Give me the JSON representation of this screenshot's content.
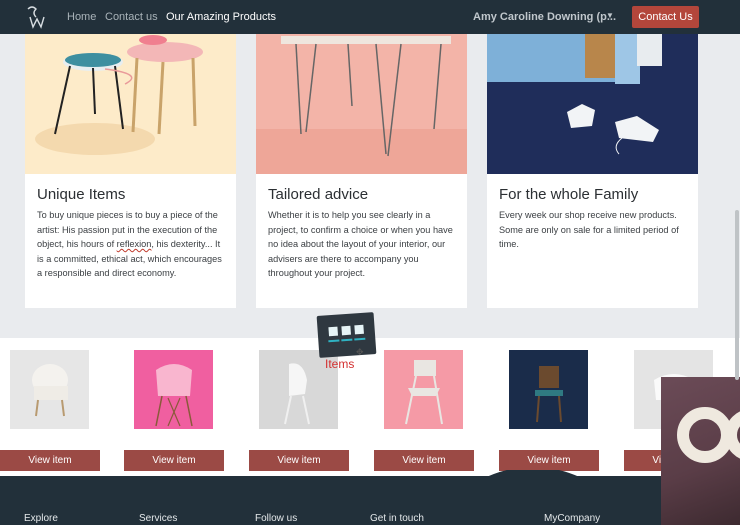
{
  "nav": {
    "links": [
      "Home",
      "Contact us",
      "Our Amazing Products"
    ],
    "user": "Amy Caroline Downing (p...",
    "cta": "Contact Us"
  },
  "cards": [
    {
      "title": "Unique Items",
      "text_pre": "To buy unique pieces is to buy a piece of the artist: His passion put in the execution of the object, his hours of ",
      "text_mark": "reflexion",
      "text_post": ", his dexterity... It is a committed, ethical act, which encourages a responsible and direct economy."
    },
    {
      "title": "Tailored advice",
      "text": "Whether it is to help you see clearly in a project, to confirm a choice or when you have no idea about the layout of your interior, our advisers are there to accompany you throughout your project."
    },
    {
      "title": "For the whole Family",
      "text": "Every week our shop receive new products. Some are only on sale for a limited period of time."
    }
  ],
  "items": {
    "button_label": "View item",
    "badge_label": "Items",
    "count": 6
  },
  "footer": {
    "columns": [
      "Explore",
      "Services",
      "Follow us",
      "Get in touch",
      "MyCompany"
    ]
  },
  "colors": {
    "navbar": "#22303a",
    "accent": "#b3463b",
    "item_button": "#9b4a45"
  }
}
